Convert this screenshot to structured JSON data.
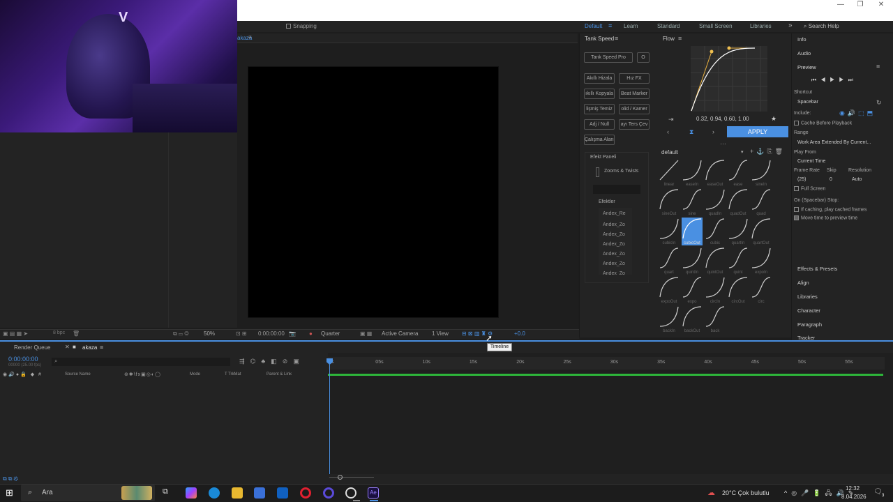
{
  "window": {
    "minimize": "—",
    "maximize": "❐",
    "close": "✕"
  },
  "toolbar": {
    "snapping": "Snapping"
  },
  "workspaces": [
    {
      "label": "Default",
      "active": true
    },
    {
      "label": "Learn"
    },
    {
      "label": "Standard"
    },
    {
      "label": "Small Screen"
    },
    {
      "label": "Libraries"
    }
  ],
  "search_help": "Search Help",
  "composition": {
    "tab": "akaza"
  },
  "viewer": {
    "zoom": "50%",
    "timecode": "0:00:00:00",
    "resolution": "Quarter",
    "camera": "Active Camera",
    "views": "1 View",
    "exposure": "+0.0",
    "bpc": "8 bpc"
  },
  "tank": {
    "title": "Tank Speed",
    "pro_button": "Tank Speed Pro",
    "o_button": "O",
    "buttons": [
      "Akıllı Hizala",
      "Hız FX",
      "ıkıllı Kopyala",
      "Beat Marker",
      "lişmiş Temiz",
      "olid / Kamer",
      "Adj / Null",
      "ayı Ters Çev",
      "Çalışma Alanı"
    ],
    "effect_panel": "Efekt Paneli",
    "zooms": "Zooms & Twists",
    "effects_label": "Efektler",
    "effects": [
      "Andex_Re",
      "Andex_Zo",
      "Andex_Zo",
      "Andex_Zo",
      "Andex_Zo",
      "Andex_Zo",
      "Andex_Zo",
      "Andex_Zo"
    ]
  },
  "flow": {
    "title": "Flow",
    "bezier": "0.32, 0.94, 0.60, 1.00",
    "apply": "APPLY",
    "preset_set": "default",
    "presets": [
      {
        "name": "linear"
      },
      {
        "name": "easeIn"
      },
      {
        "name": "easeOut"
      },
      {
        "name": "ease"
      },
      {
        "name": "sineIn"
      },
      {
        "name": "sineOut"
      },
      {
        "name": "sine"
      },
      {
        "name": "quadIn"
      },
      {
        "name": "quadOut"
      },
      {
        "name": "quad"
      },
      {
        "name": "cubicIn"
      },
      {
        "name": "cubicOut",
        "selected": true
      },
      {
        "name": "cubic"
      },
      {
        "name": "quartIn"
      },
      {
        "name": "quartOut"
      },
      {
        "name": "quart"
      },
      {
        "name": "quintIn"
      },
      {
        "name": "quintOut"
      },
      {
        "name": "quint"
      },
      {
        "name": "expoIn"
      },
      {
        "name": "expoOut"
      },
      {
        "name": "expo"
      },
      {
        "name": "circIn"
      },
      {
        "name": "circOut"
      },
      {
        "name": "circ"
      },
      {
        "name": "backIn"
      },
      {
        "name": "backOut"
      },
      {
        "name": "back"
      }
    ]
  },
  "right": {
    "info": "Info",
    "audio": "Audio",
    "preview": "Preview",
    "shortcut_label": "Shortcut",
    "shortcut": "Spacebar",
    "include": "Include:",
    "cache": "Cache Before Playback",
    "range_label": "Range",
    "range": "Work Area Extended By Current...",
    "play_from_label": "Play From",
    "play_from": "Current Time",
    "frame_rate_label": "Frame Rate",
    "skip_label": "Skip",
    "resolution_label": "Resolution",
    "frame_rate": "(25)",
    "skip": "0",
    "resolution": "Auto",
    "full_screen": "Full Screen",
    "stop_label": "On (Spacebar) Stop:",
    "if_caching": "If caching, play cached frames",
    "move_time": "Move time to preview time",
    "panels": [
      "Effects & Presets",
      "Align",
      "Libraries",
      "Character",
      "Paragraph",
      "Tracker"
    ]
  },
  "timeline": {
    "render_queue": "Render Queue",
    "comp_tab": "akaza",
    "timecode": "0:00:00:00",
    "timecode_sub": "00000 (25.00 fps)",
    "columns": {
      "source": "Source Name",
      "mode": "Mode",
      "trkmat": "T TrkMat",
      "parent": "Parent & Link"
    },
    "ticks": [
      "0s",
      "05s",
      "10s",
      "15s",
      "20s",
      "25s",
      "30s",
      "35s",
      "40s",
      "45s",
      "50s",
      "55s"
    ],
    "tooltip": "Timeline"
  },
  "taskbar": {
    "search": "Ara",
    "weather": "20°C  Çok bulutlu",
    "time": "12:32",
    "date": "8.04.2026",
    "notifications": "3"
  },
  "webcam": {
    "logo": "V"
  }
}
